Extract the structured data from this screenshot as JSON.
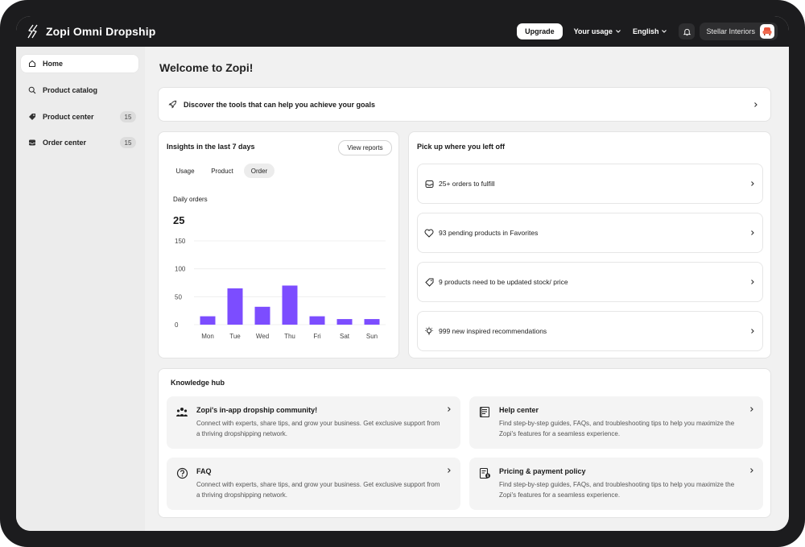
{
  "app": {
    "name": "Zopi Omni Dropship"
  },
  "topbar": {
    "upgrade_label": "Upgrade",
    "usage_label": "Your usage",
    "language_label": "English",
    "store_name": "Stellar Interiors"
  },
  "sidebar": {
    "items": [
      {
        "label": "Home",
        "icon": "home-icon",
        "active": true
      },
      {
        "label": "Product catalog",
        "icon": "search-icon"
      },
      {
        "label": "Product center",
        "icon": "tag-icon",
        "count": "15"
      },
      {
        "label": "Order center",
        "icon": "inbox-icon",
        "count": "15"
      }
    ]
  },
  "main": {
    "welcome": "Welcome to Zopi!",
    "discover": "Discover the tools that can help you achieve your goals"
  },
  "insights": {
    "title": "Insights in the last 7 days",
    "view_reports": "View reports",
    "tabs": [
      "Usage",
      "Product",
      "Order"
    ],
    "active_tab": "Order",
    "metric_label": "Daily orders",
    "metric_value": "25"
  },
  "chart_data": {
    "type": "bar",
    "categories": [
      "Mon",
      "Tue",
      "Wed",
      "Thu",
      "Fri",
      "Sat",
      "Sun"
    ],
    "values": [
      15,
      65,
      32,
      70,
      15,
      10,
      10
    ],
    "yticks": [
      0,
      50,
      100,
      150
    ],
    "ylim": [
      0,
      150
    ],
    "grid": true,
    "bar_color": "#7c4dff"
  },
  "pickup": {
    "title": "Pick up where you left off",
    "items": [
      {
        "label": "25+ orders to fulfill",
        "icon": "inbox-icon"
      },
      {
        "label": "93 pending products in Favorites",
        "icon": "heart-icon"
      },
      {
        "label": "9 products need to be updated stock/ price",
        "icon": "tag-icon"
      },
      {
        "label": "999 new inspired recommendations",
        "icon": "lightbulb-icon"
      }
    ]
  },
  "hub": {
    "title": "Knowledge hub",
    "items": [
      {
        "title": "Zopi's in-app dropship community!",
        "desc": "Connect with experts, share tips, and grow your business. Get exclusive support from a thriving dropshipping network.",
        "icon": "community-icon"
      },
      {
        "title": "Help center",
        "desc": "Find step-by-step guides, FAQs, and troubleshooting tips to help you maximize the Zopi's features for a seamless experience.",
        "icon": "book-icon"
      },
      {
        "title": "FAQ",
        "desc": "Connect with experts, share tips, and grow your business. Get exclusive support from a thriving dropshipping network.",
        "icon": "question-icon"
      },
      {
        "title": "Pricing & payment policy",
        "desc": "Find step-by-step guides, FAQs, and troubleshooting tips to help you maximize the Zopi's features for a seamless experience.",
        "icon": "pricing-icon"
      }
    ]
  }
}
